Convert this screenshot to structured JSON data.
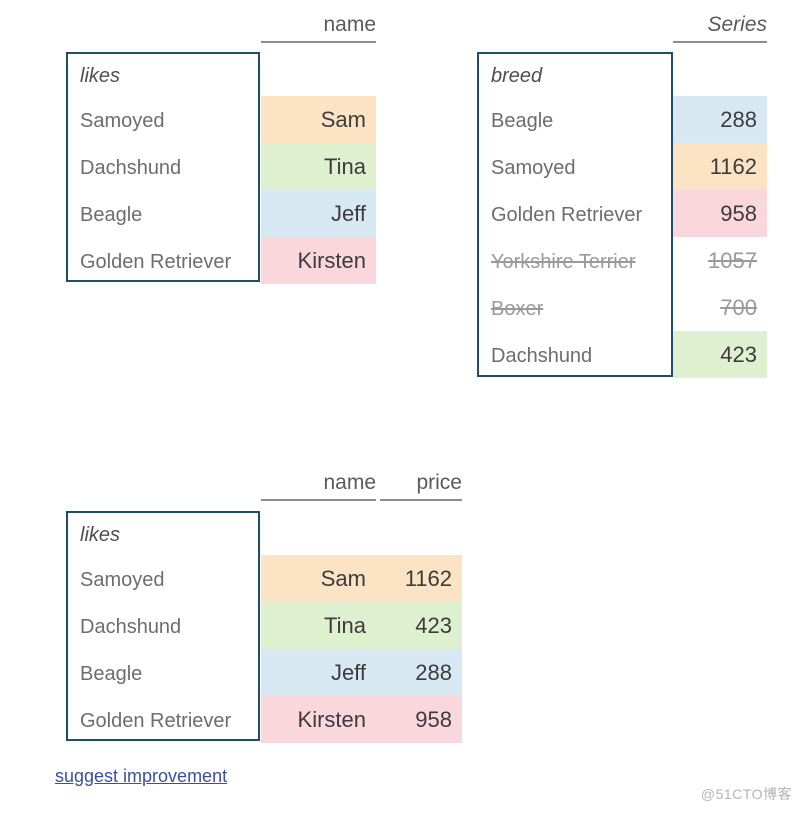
{
  "tables": [
    {
      "id": "left-name-table",
      "index_name": "likes",
      "columns": [
        {
          "label": "name",
          "italic": false
        }
      ],
      "rows": [
        {
          "index": "Samoyed",
          "values": [
            "Sam"
          ],
          "color": "#fce3c4",
          "struck": false
        },
        {
          "index": "Dachshund",
          "values": [
            "Tina"
          ],
          "color": "#dff0d0",
          "struck": false
        },
        {
          "index": "Beagle",
          "values": [
            "Jeff"
          ],
          "color": "#d8e8f2",
          "struck": false
        },
        {
          "index": "Golden Retriever",
          "values": [
            "Kirsten"
          ],
          "color": "#fad6dd",
          "struck": false
        }
      ]
    },
    {
      "id": "right-series-table",
      "index_name": "breed",
      "columns": [
        {
          "label": "Series",
          "italic": true
        }
      ],
      "rows": [
        {
          "index": "Beagle",
          "values": [
            "288"
          ],
          "color": "#d8e8f2",
          "struck": false
        },
        {
          "index": "Samoyed",
          "values": [
            "1162"
          ],
          "color": "#fce3c4",
          "struck": false
        },
        {
          "index": "Golden Retriever",
          "values": [
            "958"
          ],
          "color": "#fad6dd",
          "struck": false
        },
        {
          "index": "Yorkshire Terrier",
          "values": [
            "1057"
          ],
          "color": "#ffffff",
          "struck": true
        },
        {
          "index": "Boxer",
          "values": [
            "700"
          ],
          "color": "#ffffff",
          "struck": true
        },
        {
          "index": "Dachshund",
          "values": [
            "423"
          ],
          "color": "#dff0d0",
          "struck": false
        }
      ]
    },
    {
      "id": "bottom-joined-table",
      "index_name": "likes",
      "columns": [
        {
          "label": "name",
          "italic": false
        },
        {
          "label": "price",
          "italic": false
        }
      ],
      "rows": [
        {
          "index": "Samoyed",
          "values": [
            "Sam",
            "1162"
          ],
          "color": "#fce3c4",
          "struck": false
        },
        {
          "index": "Dachshund",
          "values": [
            "Tina",
            "423"
          ],
          "color": "#dff0d0",
          "struck": false
        },
        {
          "index": "Beagle",
          "values": [
            "Jeff",
            "288"
          ],
          "color": "#d8e8f2",
          "struck": false
        },
        {
          "index": "Golden Retriever",
          "values": [
            "Kirsten",
            "958"
          ],
          "color": "#fad6dd",
          "struck": false
        }
      ]
    }
  ],
  "footer": {
    "link_label": "suggest improvement",
    "link_color": "#3b4fa0"
  },
  "watermark": {
    "text": "@51CTO博客"
  },
  "colors": {
    "index_border": "#1f4e6b",
    "header_rule": "#8d8d8d",
    "header_text": "#5a5a5a",
    "index_text": "#6d6d6d",
    "value_text": "#3c3c3c",
    "struck_text": "#9a9a9a",
    "orange": "#fce3c4",
    "green": "#dff0d0",
    "blue": "#d8e8f2",
    "pink": "#fad6dd"
  }
}
